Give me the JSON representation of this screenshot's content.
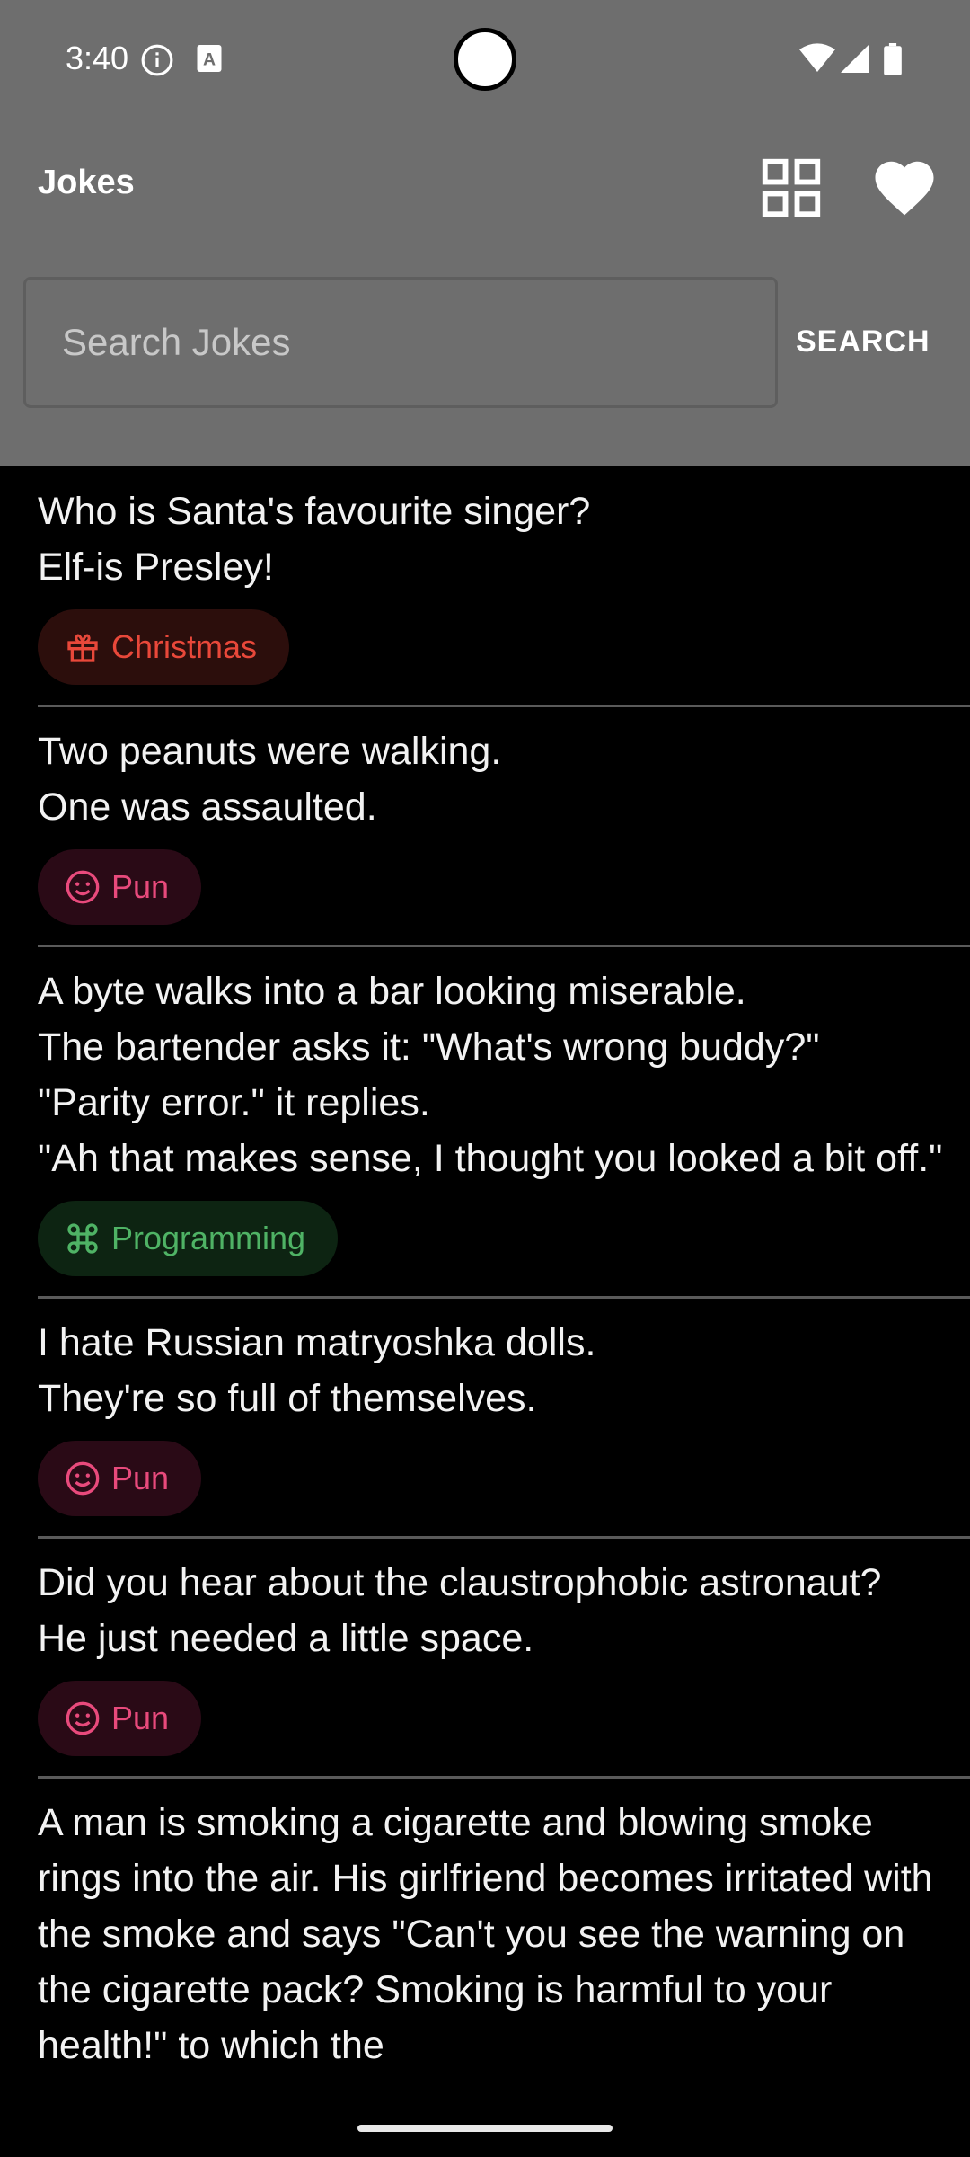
{
  "status_bar": {
    "time": "3:40",
    "icons": [
      "info-icon",
      "keyboard-a-icon",
      "wifi-icon",
      "signal-icon",
      "battery-icon"
    ]
  },
  "app_bar": {
    "title": "Jokes",
    "actions": [
      "grid-icon",
      "heart-icon"
    ]
  },
  "search": {
    "placeholder": "Search Jokes",
    "value": "",
    "button_label": "SEARCH"
  },
  "jokes": [
    {
      "text": "Who is Santa's favourite singer?\nElf-is Presley!",
      "category": "Christmas",
      "icon": "gift-icon",
      "color": "#e8483a"
    },
    {
      "text": "Two peanuts were walking.\nOne was assaulted.",
      "category": "Pun",
      "icon": "smiley-icon",
      "color": "#e84a7c"
    },
    {
      "text": "A byte walks into a bar looking miserable.\nThe bartender asks it: \"What's wrong buddy?\"\n\"Parity error.\" it replies.\n\"Ah that makes sense, I thought you looked a bit off.\"",
      "category": "Programming",
      "icon": "command-icon",
      "color": "#4fb365"
    },
    {
      "text": "I hate Russian matryoshka dolls.\nThey're so full of themselves.",
      "category": "Pun",
      "icon": "smiley-icon",
      "color": "#e84a7c"
    },
    {
      "text": "Did you hear about the claustrophobic astronaut?\nHe just needed a little space.",
      "category": "Pun",
      "icon": "smiley-icon",
      "color": "#e84a7c"
    },
    {
      "text": "A man is smoking a cigarette and blowing smoke rings into the air. His girlfriend becomes irritated with the smoke and says \"Can't you see the warning on the cigarette pack? Smoking is harmful to your health!\" to which the",
      "category": "",
      "icon": "",
      "color": ""
    }
  ]
}
